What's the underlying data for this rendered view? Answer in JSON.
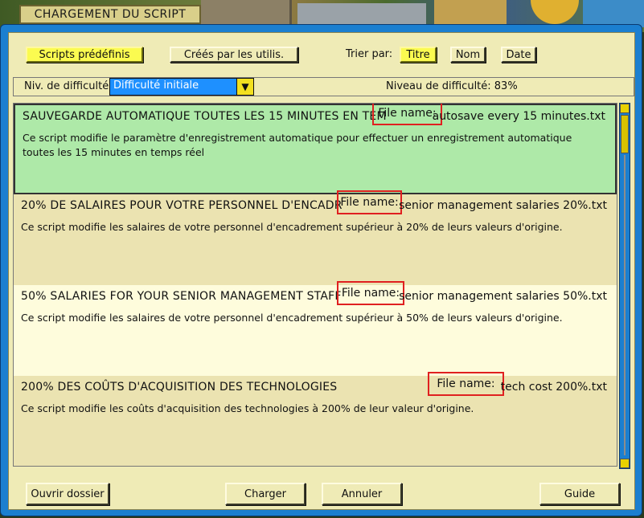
{
  "window": {
    "title": "CHARGEMENT DU SCRIPT"
  },
  "source_tabs": [
    {
      "label": "Scripts prédéfinis",
      "active": true
    },
    {
      "label": "Créés par les utilis.",
      "active": false
    }
  ],
  "sort": {
    "label": "Trier par:",
    "options": [
      {
        "label": "Titre",
        "active": true
      },
      {
        "label": "Nom",
        "active": false
      },
      {
        "label": "Date",
        "active": false
      }
    ]
  },
  "difficulty": {
    "label": "Niv. de difficulté",
    "selected": "Difficulté initiale",
    "level_text": "Niveau de difficulté: 83%"
  },
  "scripts": [
    {
      "title": "SAUVEGARDE AUTOMATIQUE TOUTES LES 15 MINUTES EN TEM",
      "file_label": "File name:",
      "file_name": "autosave every 15 minutes.txt",
      "description": "Ce script modifie le paramètre d'enregistrement automatique pour effectuer un enregistrement automatique toutes les 15 minutes en temps réel",
      "selected": true
    },
    {
      "title": "20% DE SALAIRES POUR VOTRE PERSONNEL D'ENCADR",
      "file_label": "File name:",
      "file_name": "senior management salaries 20%.txt",
      "description": "Ce script modifie les salaires de votre personnel d'encadrement supérieur à 20% de leurs valeurs d'origine.",
      "selected": false
    },
    {
      "title": "50% SALARIES FOR YOUR SENIOR MANAGEMENT STAFF",
      "file_label": "File name:",
      "file_name": "senior management salaries 50%.txt",
      "description": "Ce script modifie les salaires de votre personnel d'encadrement supérieur à 50% de leurs valeurs d'origine.",
      "selected": false
    },
    {
      "title": "200% DES COÛTS D'ACQUISITION DES TECHNOLOGIES",
      "file_label": "File name:",
      "file_name": "tech cost 200%.txt",
      "description": "Ce script modifie les coûts d'acquisition des technologies à 200% de leur valeur d'origine.",
      "selected": false
    }
  ],
  "footer": {
    "open_folder": "Ouvrir dossier",
    "load": "Charger",
    "cancel": "Annuler",
    "guide": "Guide"
  },
  "colors": {
    "frame_blue": "#1b7fd0",
    "panel": "#efebb6",
    "active_yellow": "#fbfb50",
    "selected_row": "#aee9a8",
    "highlight_red": "#e02020"
  }
}
